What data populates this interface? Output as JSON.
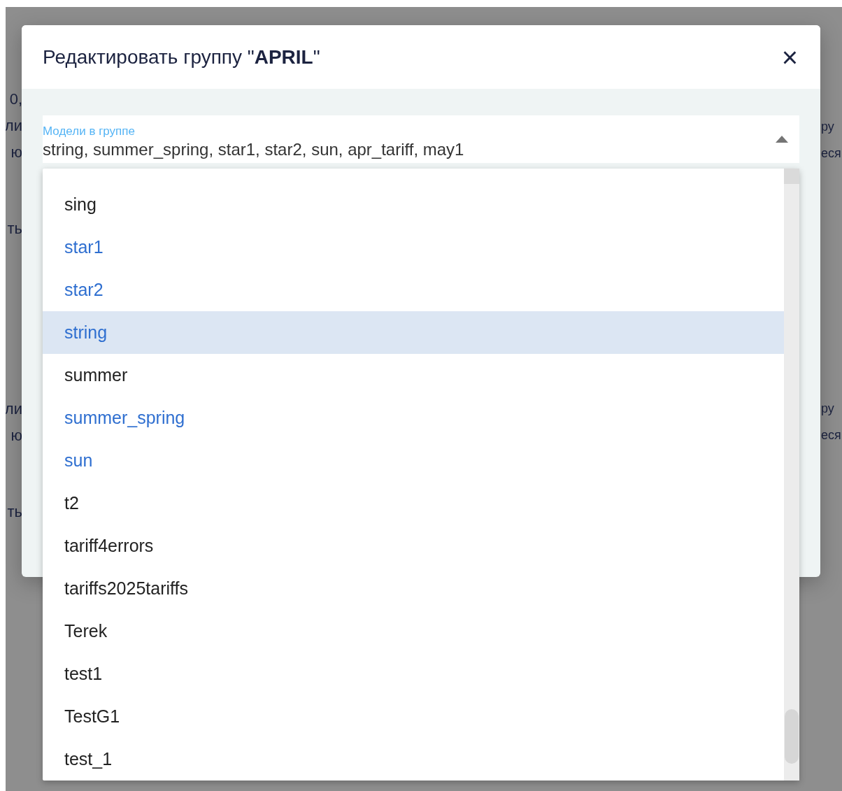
{
  "background": {
    "left_fragments": [
      "0,",
      "ли",
      "ю",
      "ть",
      "ли",
      "ю",
      "ть"
    ],
    "right_fragments": [
      "ру",
      "еся",
      "ру",
      "еся"
    ]
  },
  "dialog": {
    "title": "Редактировать группу \"**APRIL**\"",
    "close": "×"
  },
  "field": {
    "label": "Модели в группе",
    "value": "string, summer_spring, star1, star2, sun, apr_tariff, may1",
    "expanded": true
  },
  "options": [
    {
      "label": "sing",
      "selected": false,
      "focused": false
    },
    {
      "label": "star1",
      "selected": true,
      "focused": false
    },
    {
      "label": "star2",
      "selected": true,
      "focused": false
    },
    {
      "label": "string",
      "selected": true,
      "focused": true
    },
    {
      "label": "summer",
      "selected": false,
      "focused": false
    },
    {
      "label": "summer_spring",
      "selected": true,
      "focused": false
    },
    {
      "label": "sun",
      "selected": true,
      "focused": false
    },
    {
      "label": "t2",
      "selected": false,
      "focused": false
    },
    {
      "label": "tariff4errors",
      "selected": false,
      "focused": false
    },
    {
      "label": "tariffs2025tariffs",
      "selected": false,
      "focused": false
    },
    {
      "label": "Terek",
      "selected": false,
      "focused": false
    },
    {
      "label": "test1",
      "selected": false,
      "focused": false
    },
    {
      "label": "TestG1",
      "selected": false,
      "focused": false
    },
    {
      "label": "test_1",
      "selected": false,
      "focused": false
    }
  ]
}
